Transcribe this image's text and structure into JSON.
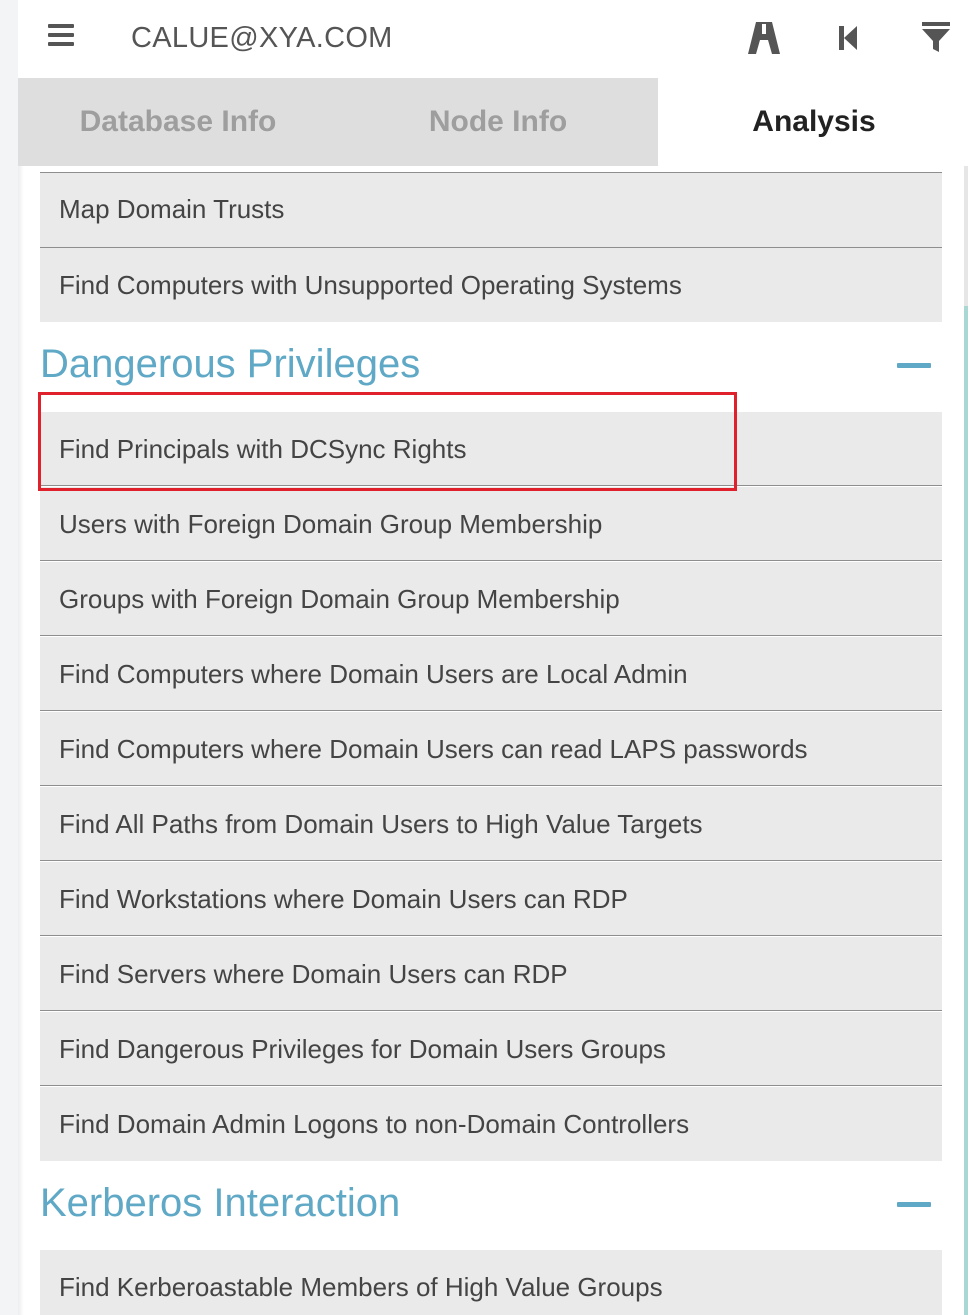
{
  "header": {
    "user": "CALUE@XYA.COM",
    "icons": [
      "menu-icon",
      "path-icon",
      "back-icon",
      "filter-icon"
    ]
  },
  "tabs": [
    {
      "label": "Database Info",
      "active": false
    },
    {
      "label": "Node Info",
      "active": false
    },
    {
      "label": "Analysis",
      "active": true
    }
  ],
  "list": {
    "pre_items": [
      {
        "label": "Map Domain Trusts"
      },
      {
        "label": "Find Computers with Unsupported Operating Systems"
      }
    ],
    "sections": [
      {
        "title": "Dangerous Privileges",
        "items": [
          {
            "label": "Find Principals with DCSync Rights",
            "highlighted": true
          },
          {
            "label": "Users with Foreign Domain Group Membership"
          },
          {
            "label": "Groups with Foreign Domain Group Membership"
          },
          {
            "label": "Find Computers where Domain Users are Local Admin"
          },
          {
            "label": "Find Computers where Domain Users can read LAPS passwords"
          },
          {
            "label": "Find All Paths from Domain Users to High Value Targets"
          },
          {
            "label": "Find Workstations where Domain Users can RDP"
          },
          {
            "label": "Find Servers where Domain Users can RDP"
          },
          {
            "label": "Find Dangerous Privileges for Domain Users Groups"
          },
          {
            "label": "Find Domain Admin Logons to non-Domain Controllers"
          }
        ]
      },
      {
        "title": "Kerberos Interaction",
        "items": [
          {
            "label": "Find Kerberoastable Members of High Value Groups"
          }
        ]
      }
    ]
  },
  "colors": {
    "section_title": "#5fa8c6",
    "highlight_border": "#e0202a",
    "item_background": "#eaeaea",
    "tab_inactive": "#dedede"
  }
}
